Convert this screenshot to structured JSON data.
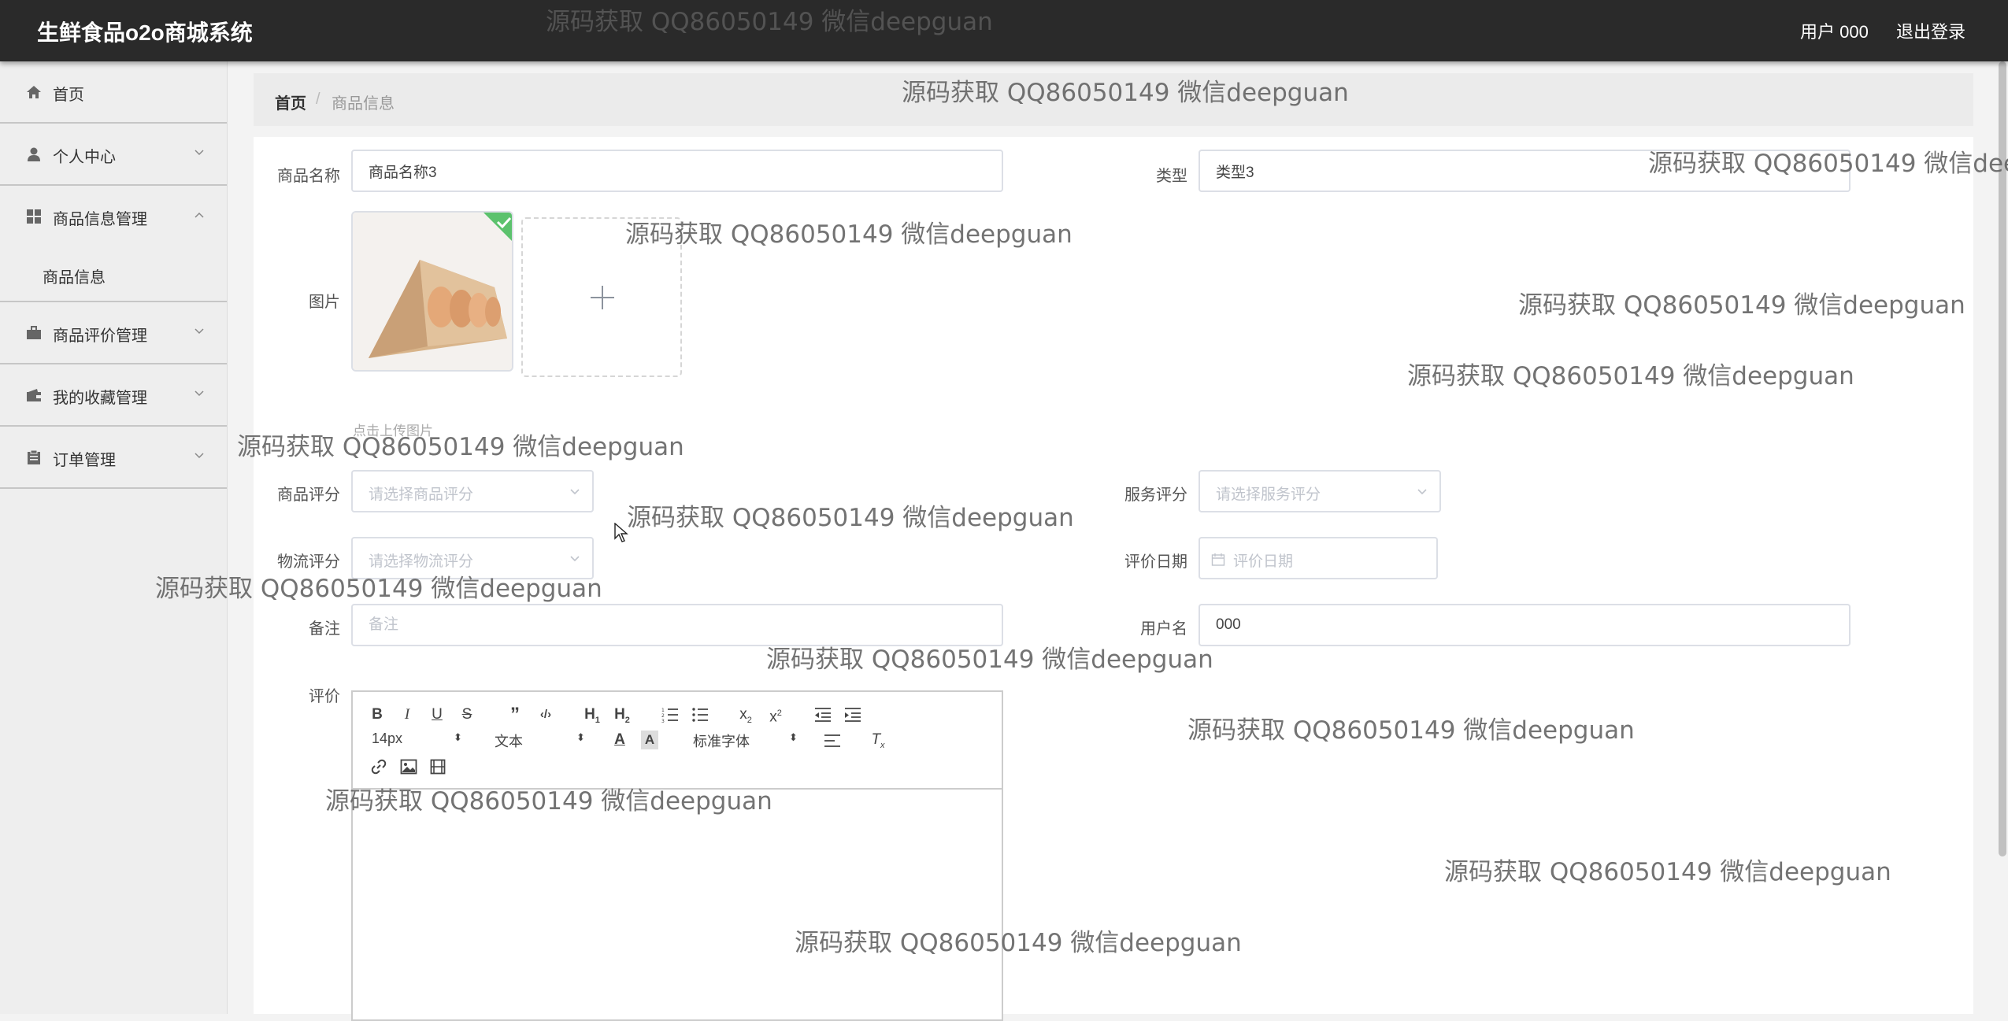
{
  "header": {
    "app_title": "生鲜食品o2o商城系统",
    "user_label": "用户 000",
    "logout_label": "退出登录"
  },
  "sidebar": {
    "items": [
      {
        "label": "首页",
        "icon": "home-icon"
      },
      {
        "label": "个人中心",
        "icon": "user-icon"
      },
      {
        "label": "商品信息管理",
        "icon": "grid-icon"
      },
      {
        "label": "商品信息",
        "icon": ""
      },
      {
        "label": "商品评价管理",
        "icon": "briefcase-icon"
      },
      {
        "label": "我的收藏管理",
        "icon": "wallet-icon"
      },
      {
        "label": "订单管理",
        "icon": "clipboard-icon"
      }
    ]
  },
  "breadcrumb": {
    "home": "首页",
    "separator": "/",
    "current": "商品信息"
  },
  "form": {
    "product_name_label": "商品名称",
    "product_name_value": "商品名称3",
    "type_label": "类型",
    "type_value": "类型3",
    "image_label": "图片",
    "upload_tip": "点击上传图片",
    "product_rating_label": "商品评分",
    "product_rating_placeholder": "请选择商品评分",
    "service_rating_label": "服务评分",
    "service_rating_placeholder": "请选择服务评分",
    "logistics_rating_label": "物流评分",
    "logistics_rating_placeholder": "请选择物流评分",
    "review_date_label": "评价日期",
    "review_date_placeholder": "评价日期",
    "note_label": "备注",
    "note_placeholder": "备注",
    "username_label": "用户名",
    "username_value": "000",
    "review_label": "评价"
  },
  "editor": {
    "font_size": "14px",
    "block_type": "文本",
    "font_family": "标准字体"
  },
  "watermark_text": "源码获取 QQ86050149 微信deepguan",
  "colors": {
    "header_bg": "#2a2a2a",
    "sidebar_bg": "#eeeeee",
    "check_badge": "#5cc26d"
  }
}
